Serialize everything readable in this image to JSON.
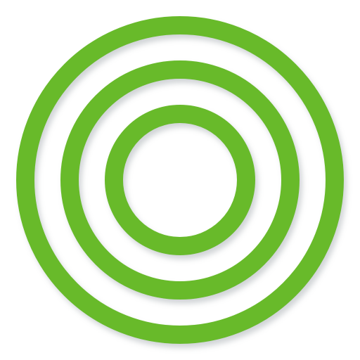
{
  "icon": {
    "name": "concentric-rings-icon",
    "ring_count": 3
  },
  "colors": {
    "ring": "#68ba2c",
    "shadow": "#9aa0a6",
    "background": "#ffffff"
  }
}
